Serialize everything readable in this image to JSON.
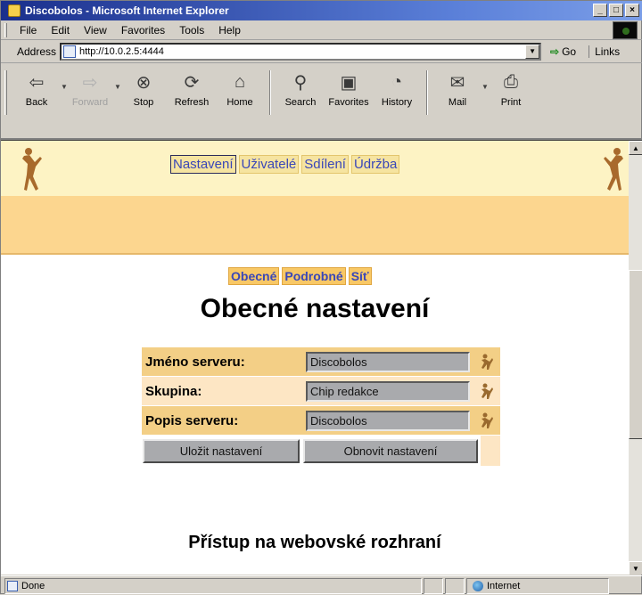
{
  "window": {
    "title": "Discobolos - Microsoft Internet Explorer",
    "controls": [
      "_",
      "□",
      "×"
    ]
  },
  "menu": [
    "File",
    "Edit",
    "View",
    "Favorites",
    "Tools",
    "Help"
  ],
  "address": {
    "label": "Address",
    "url": "http://10.0.2.5:4444",
    "go_label": "Go",
    "links_label": "Links"
  },
  "toolbar": [
    {
      "label": "Back",
      "icon": "back-arrow-icon",
      "enabled": true
    },
    {
      "label": "Forward",
      "icon": "forward-arrow-icon",
      "enabled": false
    },
    {
      "label": "Stop",
      "icon": "stop-icon",
      "enabled": true
    },
    {
      "label": "Refresh",
      "icon": "refresh-icon",
      "enabled": true
    },
    {
      "label": "Home",
      "icon": "home-icon",
      "enabled": true
    },
    {
      "label": "Search",
      "icon": "search-icon",
      "enabled": true
    },
    {
      "label": "Favorites",
      "icon": "favorites-icon",
      "enabled": true
    },
    {
      "label": "History",
      "icon": "history-icon",
      "enabled": true
    },
    {
      "label": "Mail",
      "icon": "mail-icon",
      "enabled": true
    },
    {
      "label": "Print",
      "icon": "print-icon",
      "enabled": true
    }
  ],
  "page": {
    "nav_main": [
      {
        "label": "Nastavení",
        "active": true
      },
      {
        "label": "Uživatelé",
        "active": false
      },
      {
        "label": "Sdílení",
        "active": false
      },
      {
        "label": "Údržba",
        "active": false
      }
    ],
    "nav_sub": [
      {
        "label": "Obecné"
      },
      {
        "label": "Podrobné"
      },
      {
        "label": "Síť"
      }
    ],
    "title": "Obecné nastavení",
    "form": {
      "rows": [
        {
          "label": "Jméno serveru:",
          "value": "Discobolos"
        },
        {
          "label": "Skupina:",
          "value": "Chip redakce"
        },
        {
          "label": "Popis serveru:",
          "value": "Discobolos"
        }
      ],
      "save_label": "Uložit nastavení",
      "reset_label": "Obnovit nastavení"
    },
    "subtitle": "Přístup na webovské rozhraní"
  },
  "status": {
    "text": "Done",
    "zone": "Internet"
  },
  "colors": {
    "banner_light": "#fdf3c4",
    "banner_mid": "#fcd68f",
    "link": "#3a47b8",
    "titlebar": "#1a2f8c"
  }
}
